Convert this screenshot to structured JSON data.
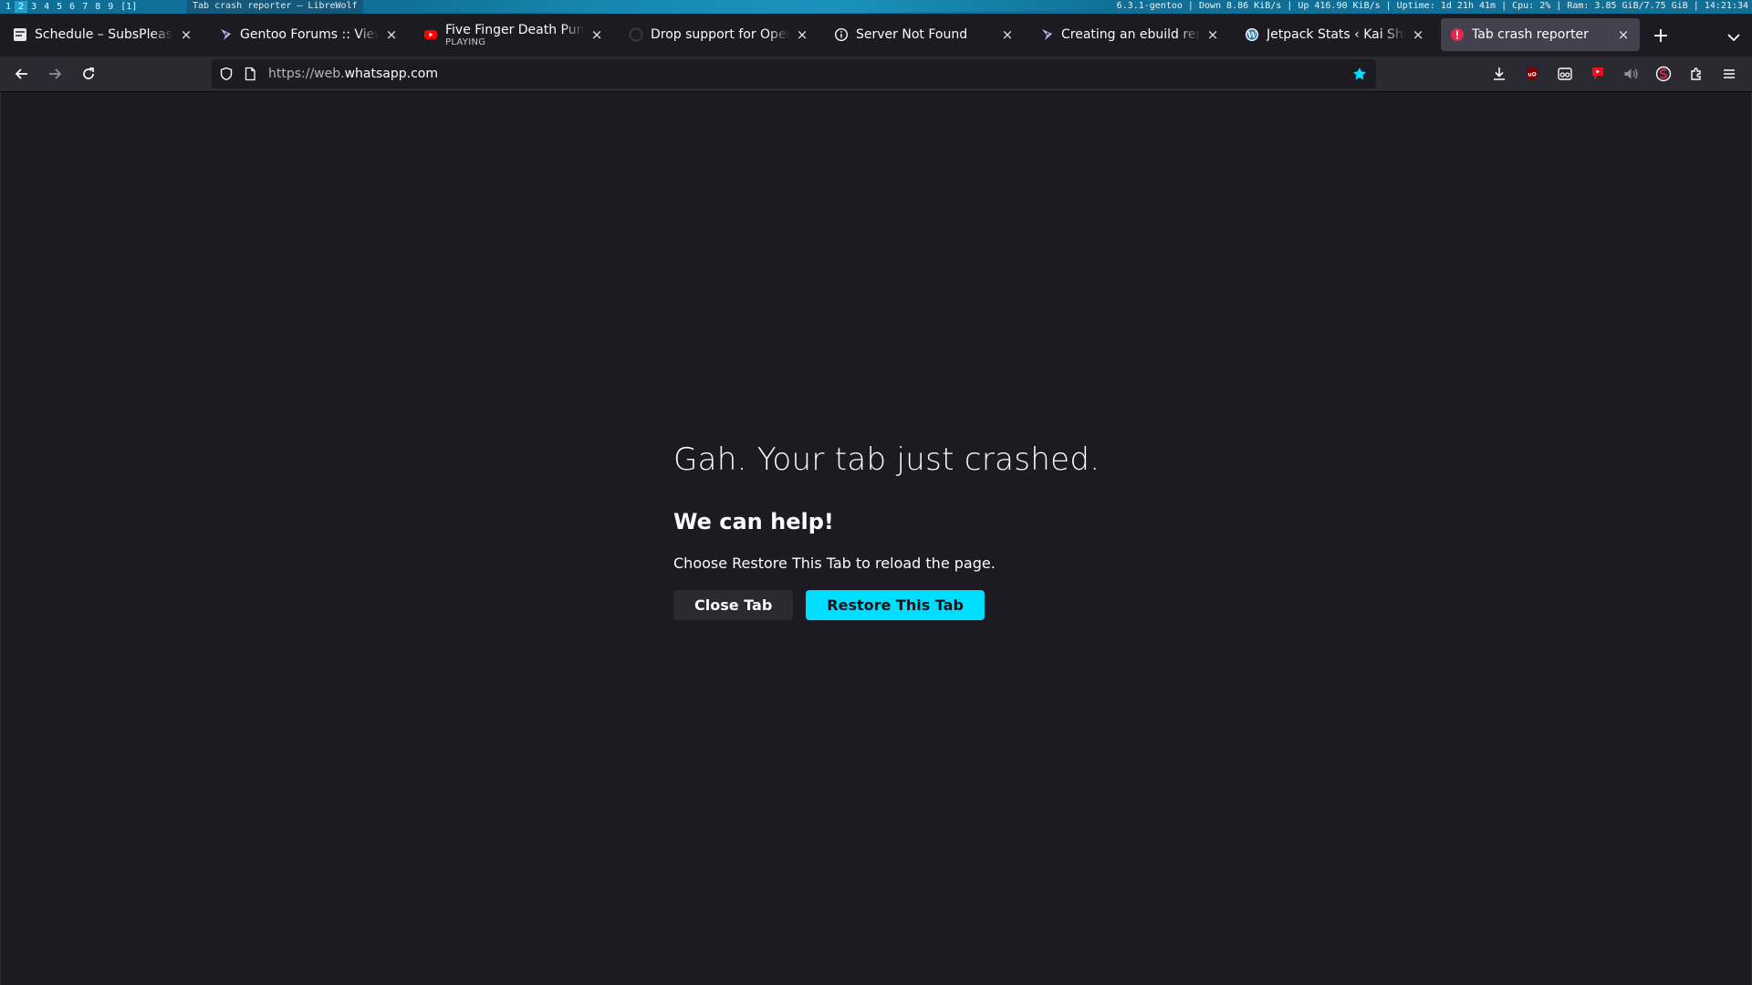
{
  "wm": {
    "workspaces": [
      "1",
      "2",
      "3",
      "4",
      "5",
      "6",
      "7",
      "8",
      "9",
      "[1]"
    ],
    "active_workspace": "2",
    "window_title": "Tab crash reporter — LibreWolf",
    "status": "6.3.1-gentoo | Down 8.86 KiB/s | Up 416.90 KiB/s | Uptime: 1d 21h 41m | Cpu: 2% | Ram: 3.85 GiB/7.75 GiB | 14:21:34"
  },
  "tabs": [
    {
      "label": "Schedule – SubsPlease",
      "icon": "subsplease-icon"
    },
    {
      "label": "Gentoo Forums :: View to",
      "icon": "gentoo-icon"
    },
    {
      "label": "Five Finger Death Punch",
      "sub": "PLAYING",
      "icon": "youtube-icon"
    },
    {
      "label": "Drop support for OpenSS",
      "icon": "github-icon"
    },
    {
      "label": "Server Not Found",
      "icon": "info-icon"
    },
    {
      "label": "Creating an ebuild reposi",
      "icon": "gentoo-icon"
    },
    {
      "label": "Jetpack Stats ‹ Kai Shin J",
      "icon": "wordpress-icon"
    },
    {
      "label": "Tab crash reporter",
      "icon": "warning-icon",
      "selected": true
    }
  ],
  "urlbar": {
    "url_prefix": "https://web.",
    "url_domain": "whatsapp.com",
    "url_suffix": ""
  },
  "crash": {
    "title": "Gah. Your tab just crashed.",
    "subtitle": "We can help!",
    "message": "Choose Restore This Tab to reload the page.",
    "close_button": "Close Tab",
    "restore_button": "Restore This Tab"
  },
  "colors": {
    "accent": "#00ddff",
    "background": "#1c1b22",
    "toolbar": "#2b2a33"
  }
}
